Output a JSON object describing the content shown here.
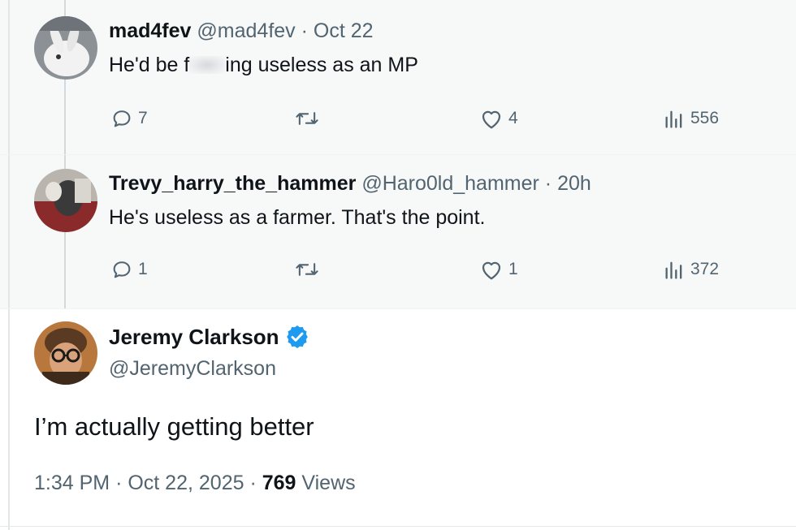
{
  "reply1": {
    "display_name": "mad4fev",
    "handle": "@mad4fev",
    "separator": "·",
    "time": "Oct 22",
    "text_before": "He'd be f",
    "text_after": "ing useless as an MP",
    "replies": "7",
    "retweets": "",
    "likes": "4",
    "views": "556"
  },
  "reply2": {
    "display_name": "Trevy_harry_the_hammer",
    "handle": "@Haro0ld_hammer",
    "separator": "·",
    "time": "20h",
    "text": "He's useless as a farmer. That's the point.",
    "replies": "1",
    "retweets": "",
    "likes": "1",
    "views": "372"
  },
  "main": {
    "display_name": "Jeremy Clarkson",
    "handle": "@JeremyClarkson",
    "text": "I’m actually getting better",
    "time": "1:34 PM",
    "separator": "·",
    "date": "Oct 22, 2025",
    "views_count": "769",
    "views_label": "Views"
  },
  "icons": {
    "reply": "reply-bubble-icon",
    "retweet": "retweet-icon",
    "like": "heart-icon",
    "views": "views-bar-chart-icon",
    "verified": "verified-badge-icon"
  },
  "colors": {
    "verified_blue": "#1d9bf0",
    "secondary_text": "#536471",
    "primary_text": "#0f1419"
  }
}
